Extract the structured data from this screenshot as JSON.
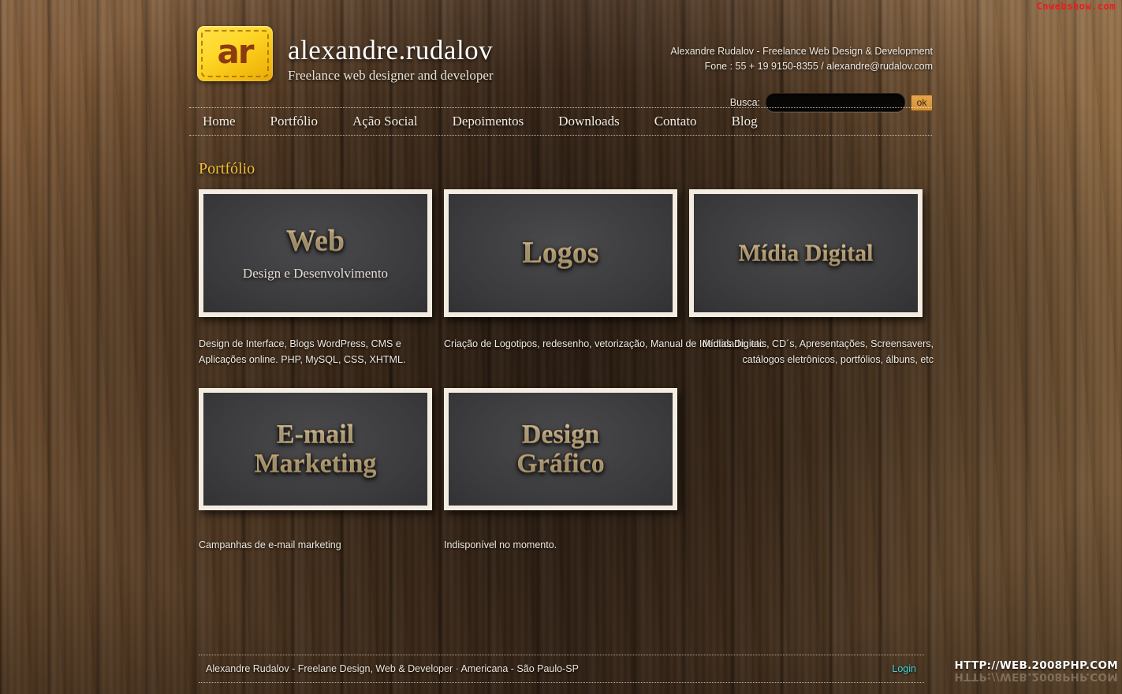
{
  "watermarks": {
    "top_right": "Cnwebshow.com",
    "bottom_right": "HTTP://WEB.2008PHP.COM",
    "red_hex": "#e81d1d"
  },
  "header": {
    "logo_mark": "ar",
    "brand_name": "alexandre.rudalov",
    "brand_tagline": "Freelance web designer and developer",
    "contact_line1": "Alexandre Rudalov - Freelance Web Design & Development",
    "contact_line2": "Fone : 55 + 19 9150-8355 / alexandre@rudalov.com",
    "search_label": "Busca:",
    "search_value": "",
    "search_placeholder": "",
    "search_button": "ok",
    "accent_hex": "#d08f34"
  },
  "nav": {
    "items": [
      {
        "label": "Home"
      },
      {
        "label": "Portfólio"
      },
      {
        "label": "Ação Social"
      },
      {
        "label": "Depoimentos"
      },
      {
        "label": "Downloads"
      },
      {
        "label": "Contato"
      },
      {
        "label": "Blog"
      }
    ]
  },
  "main": {
    "page_title": "Portfólio",
    "title_hex": "#f3bf35",
    "cards": [
      {
        "title": "Web",
        "subtitle": "Design e Desenvolvimento",
        "description": "Design de Interface, Blogs WordPress, CMS e Aplicações online. PHP, MySQL, CSS, XHTML."
      },
      {
        "title": "Logos",
        "subtitle": "",
        "description": "Criação de Logotipos, redesenho, vetorização, Manual de Identidade, etc"
      },
      {
        "title": "Mídia Digital",
        "subtitle": "",
        "description": "Mídias Digitais, CD´s, Apresentações, Screensavers, catálogos eletrônicos, portfólios, álbuns, etc"
      },
      {
        "title": "E-mail Marketing",
        "subtitle": "",
        "description": "Campanhas de e-mail marketing"
      },
      {
        "title": "Design Gráfico",
        "subtitle": "",
        "description": "Indisponível no momento."
      }
    ]
  },
  "footer": {
    "copyright": "Alexandre Rudalov - Freelane Design, Web & Developer · Americana - São Paulo-SP",
    "login_label": "Login",
    "login_hex": "#3fd4d4"
  }
}
